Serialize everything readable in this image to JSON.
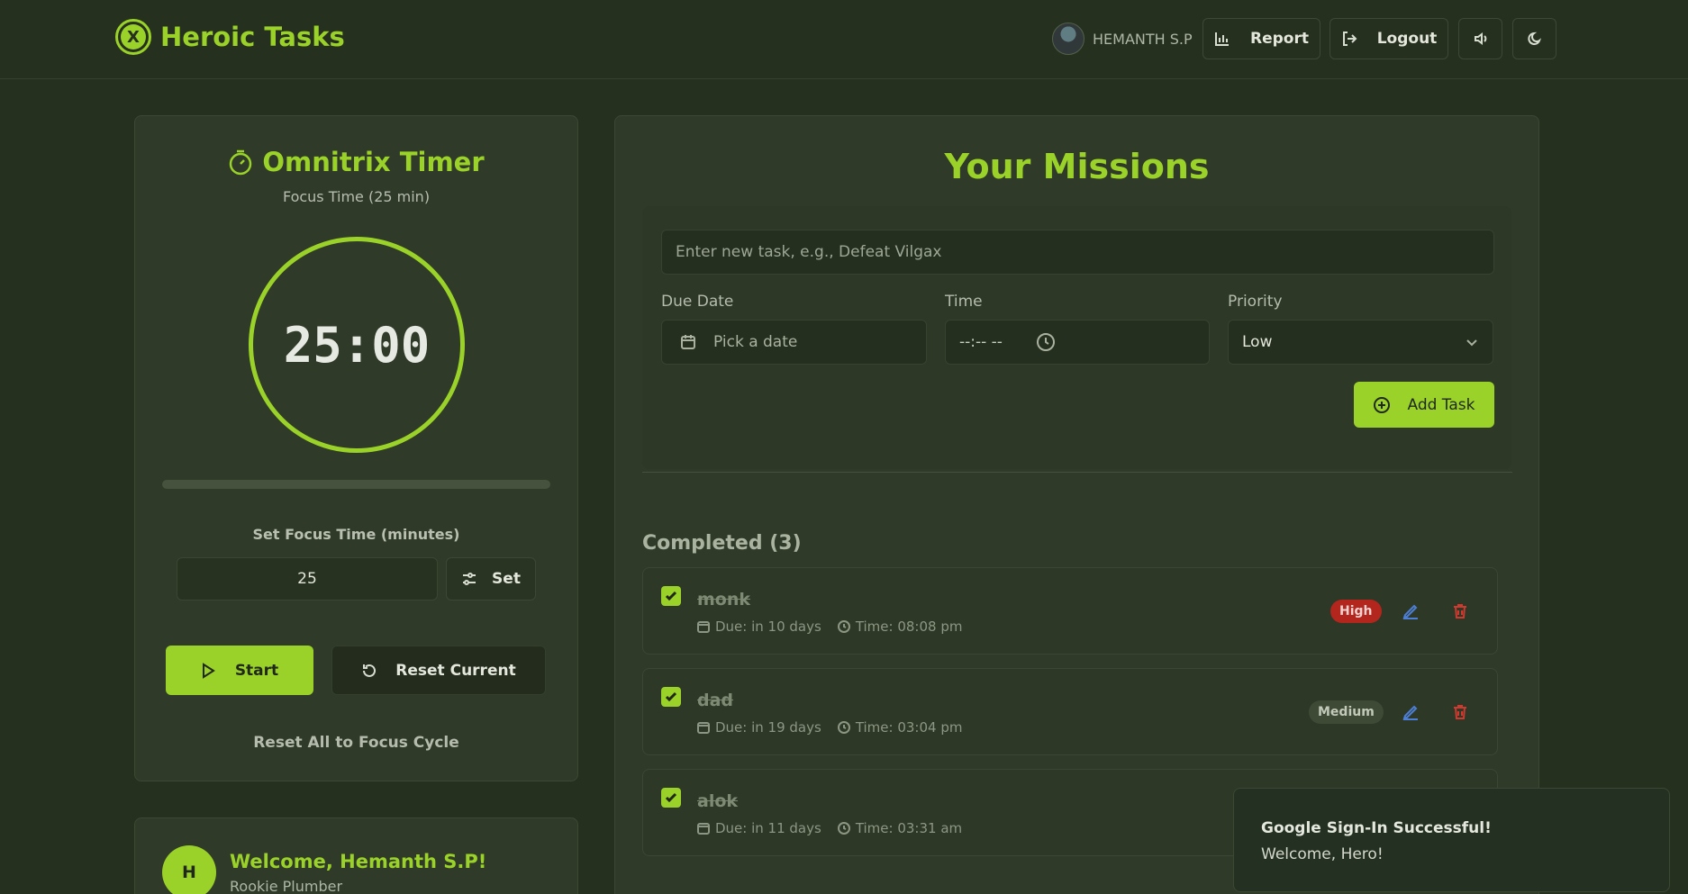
{
  "app": {
    "title": "Heroic Tasks",
    "user_name": "HEMANTH S.P",
    "report_label": "Report",
    "logout_label": "Logout"
  },
  "timer": {
    "title": "Omnitrix Timer",
    "subtitle": "Focus Time (25 min)",
    "display": "25:00",
    "progress": 0,
    "focus_label": "Set Focus Time (minutes)",
    "focus_value": "25",
    "set_label": "Set",
    "start_label": "Start",
    "reset_current_label": "Reset Current",
    "reset_all_label": "Reset All to Focus Cycle"
  },
  "welcome": {
    "initial": "H",
    "name": "Welcome, Hemanth S.P!",
    "rank": "Rookie Plumber"
  },
  "missions": {
    "title": "Your Missions",
    "task_placeholder": "Enter new task, e.g., Defeat Vilgax",
    "due_date_label": "Due Date",
    "date_placeholder": "Pick a date",
    "time_label": "Time",
    "time_placeholder": "--:-- --",
    "priority_label": "Priority",
    "priority_value": "Low",
    "add_task_label": "Add Task",
    "completed_heading": "Completed (3)",
    "tasks": [
      {
        "name": "monk",
        "due": "Due: in 10 days",
        "time": "Time: 08:08 pm",
        "priority": "High"
      },
      {
        "name": "dad",
        "due": "Due: in 19 days",
        "time": "Time: 03:04 pm",
        "priority": "Medium"
      },
      {
        "name": "alok",
        "due": "Due: in 11 days",
        "time": "Time: 03:31 am",
        "priority": ""
      }
    ]
  },
  "toast": {
    "title": "Google Sign-In Successful!",
    "message": "Welcome, Hero!"
  },
  "colors": {
    "accent": "#9ad22a",
    "background": "#26301f",
    "panel": "#2f3a28",
    "high": "#b3261e"
  }
}
